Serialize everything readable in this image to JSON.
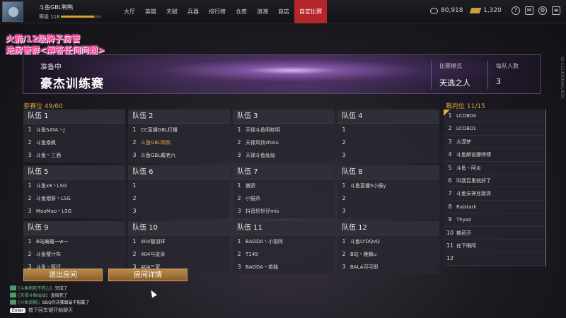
{
  "user": {
    "name": "斗鱼GBL鸭鸭",
    "level": "等级 118",
    "xp_fraction": 0.82
  },
  "nav": [
    "大厅",
    "英雄",
    "天赋",
    "兵器",
    "排行榜",
    "仓库",
    "浪潮",
    "商店",
    "自定比赛"
  ],
  "nav_active": 8,
  "currency": {
    "coins": "80,918",
    "gold": "1,320"
  },
  "top_icons": [
    "help-icon",
    "mail-icon",
    "settings-icon",
    "menu-icon"
  ],
  "overlay": {
    "line1": "火箭/12级牌子房管",
    "line2": "进房管群<解答任何问题>"
  },
  "banner": {
    "status": "准备中",
    "title": "豪杰训练赛",
    "mode_label": "比赛模式",
    "mode_value": "天选之人",
    "per_team_label": "每队人数",
    "per_team_value": "3"
  },
  "participants_label": "参赛位  49/60",
  "referees_label": "裁判位  11/15",
  "teams": [
    {
      "name": "队伍 1",
      "slots": [
        "斗鱼SAYA丶J",
        "斗鱼南枫",
        "斗鱼丶三酒"
      ]
    },
    {
      "name": "队伍 2",
      "slots": [
        "CC直播GBL打播",
        "斗鱼GBL鸭鸭",
        "斗鱼GBL戴老六"
      ]
    },
    {
      "name": "队伍 3",
      "slots": [
        "天禄斗鱼明舵明",
        "天禄风铃zhiou",
        "天禄斗鱼灿灿"
      ]
    },
    {
      "name": "队伍 4",
      "slots": [
        "",
        "",
        ""
      ]
    },
    {
      "name": "队伍 5",
      "slots": [
        "斗鱼x8丶LSG",
        "斗鱼烟祭丶LSG",
        "MaoMao丶LSG"
      ]
    },
    {
      "name": "队伍 6",
      "slots": [
        "",
        "",
        ""
      ]
    },
    {
      "name": "队伍 7",
      "slots": [
        "傲骄",
        "小猫杀",
        "抖音轩轩仔mis"
      ]
    },
    {
      "name": "队伍 8",
      "slots": [
        "斗鱼直播5小振y",
        "",
        ""
      ]
    },
    {
      "name": "队伍 9",
      "slots": [
        "B站蝙蝠一w一",
        "斗鱼樱汁布",
        "斗鱼丶甄仔"
      ]
    },
    {
      "name": "队伍 10",
      "slots": [
        "404靓羽祥",
        "404与星诉",
        "404三宽"
      ]
    },
    {
      "name": "队伍 11",
      "slots": [
        "BAODA丶小锐阿",
        "T149",
        "BAODA丶若独"
      ]
    },
    {
      "name": "队伍 12",
      "slots": [
        "斗鱼LYDQvQ",
        "B站丶晚枫u",
        "BALA可可即"
      ]
    }
  ],
  "highlight_slot": {
    "team": 1,
    "slot": 1
  },
  "referees": [
    "LCOB04",
    "LCOB01",
    "大漠梦",
    "斗鱼解说爆师傅",
    "斗鱼丶阿炎",
    "叫我百里就好了",
    "斗鱼安神豆腐清",
    "Raistark",
    "Thyaz",
    "楠芭芬",
    "在下眼阿",
    "",
    ""
  ],
  "buttons": {
    "leave": "退出房间",
    "details": "房间详情"
  },
  "chat": [
    {
      "sender": "[斗鱼明舵不死心]:",
      "msg": "完成了"
    },
    {
      "sender": "[天禄斗鱼灿灿]:",
      "msg": "直接死了"
    },
    {
      "sender": "[斗鱼南枫]:",
      "msg": "BBQ你决赛跟最不服戴了"
    }
  ],
  "chat_input": {
    "key": "Enter",
    "hint": "按下回车键开始聊天"
  },
  "side_id": "ID:15130000610CN",
  "colors": {
    "accent": "#b5262a",
    "gold": "#d9a444",
    "pink": "#ff3aa0"
  }
}
